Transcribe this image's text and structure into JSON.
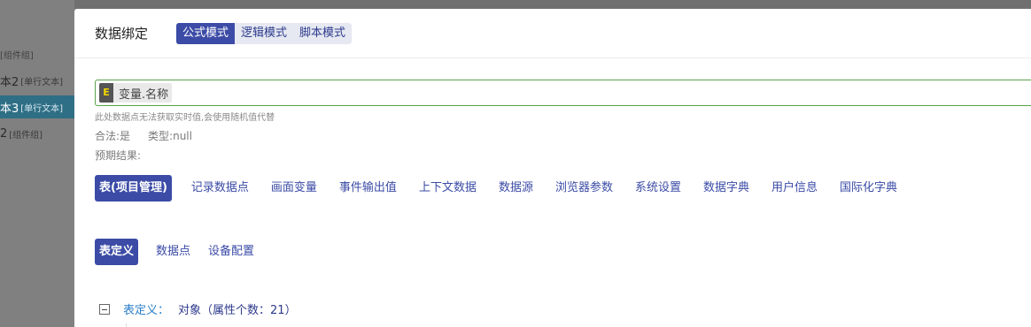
{
  "background_tree": {
    "items": [
      {
        "label": "",
        "tag": "[组件组]"
      },
      {
        "label": "本2",
        "tag": "[单行文本]"
      },
      {
        "label": "本3",
        "tag": "[单行文本]"
      },
      {
        "label": "2",
        "tag": "[组件组]"
      }
    ]
  },
  "dialog": {
    "title": "数据绑定",
    "modes": [
      {
        "label": "公式模式",
        "active": true
      },
      {
        "label": "逻辑模式",
        "active": false
      },
      {
        "label": "脚本模式",
        "active": false
      }
    ],
    "formula": {
      "token_badge": "E",
      "token_text": "变量.名称"
    },
    "hint": "此处数据点无法获取实时值,会使用随机值代替",
    "valid_text": "合法:是",
    "type_text": "类型:null",
    "expected_text": "预期结果:",
    "source_tabs": [
      {
        "label": "表(项目管理)",
        "active": true
      },
      {
        "label": "记录数据点"
      },
      {
        "label": "画面变量"
      },
      {
        "label": "事件输出值"
      },
      {
        "label": "上下文数据"
      },
      {
        "label": "数据源"
      },
      {
        "label": "浏览器参数"
      },
      {
        "label": "系统设置"
      },
      {
        "label": "数据字典"
      },
      {
        "label": "用户信息"
      },
      {
        "label": "国际化字典"
      }
    ],
    "sub_tabs": [
      {
        "label": "表定义",
        "active": true
      },
      {
        "label": "数据点"
      },
      {
        "label": "设备配置"
      }
    ],
    "tree": {
      "key": "表定义",
      "colon": "：",
      "type_desc": "对象（属性个数：21）"
    }
  }
}
